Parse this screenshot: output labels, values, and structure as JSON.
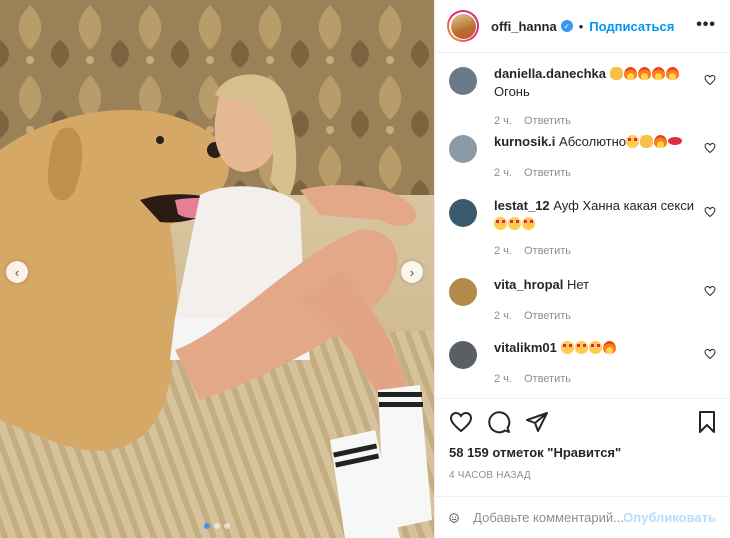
{
  "header": {
    "username": "offi_hanna",
    "separator": "•",
    "follow_label": "Подписаться",
    "more_label": "•••"
  },
  "comments": [
    {
      "user": "daniella.danechka",
      "text": "",
      "emojis": [
        "clap",
        "fire",
        "fire",
        "fire",
        "fire"
      ],
      "extra": "Огонь",
      "time": "2 ч.",
      "reply": "Ответить",
      "avatar_color": "#6b7a8a"
    },
    {
      "user": "kurnosik.i",
      "text": "Абсолютно",
      "emojis": [
        "heart-eyes",
        "clap",
        "fire",
        "lips"
      ],
      "extra": "",
      "time": "2 ч.",
      "reply": "Ответить",
      "avatar_color": "#8c9aa6"
    },
    {
      "user": "lestat_12",
      "text": "Ауф Ханна какая секси",
      "emojis": [],
      "extra_emojis": [
        "heart-eyes",
        "heart-eyes",
        "heart-eyes"
      ],
      "extra": "",
      "time": "2 ч.",
      "reply": "Ответить",
      "avatar_color": "#3b5a6e"
    },
    {
      "user": "vita_hropal",
      "text": "Нет",
      "emojis": [],
      "extra": "",
      "time": "2 ч.",
      "reply": "Ответить",
      "avatar_color": "#b48a4a"
    },
    {
      "user": "vitalikm01",
      "text": "",
      "emojis": [
        "heart-eyes",
        "heart-eyes",
        "heart-eyes",
        "fire"
      ],
      "extra": "",
      "time": "2 ч.",
      "reply": "Ответить",
      "avatar_color": "#5a5f66"
    }
  ],
  "likes": "58 159 отметок \"Нравится\"",
  "time_ago": "4 ЧАСОВ НАЗАД",
  "add_comment": {
    "placeholder": "Добавьте комментарий...",
    "publish_label": "Опубликовать"
  },
  "carousel": {
    "prev_label": "‹",
    "next_label": "›",
    "slide_count": 3,
    "active_index": 0
  },
  "colors": {
    "accent": "#0095f6",
    "publish_disabled": "#b2dffc",
    "muted": "#8e8e8e"
  }
}
